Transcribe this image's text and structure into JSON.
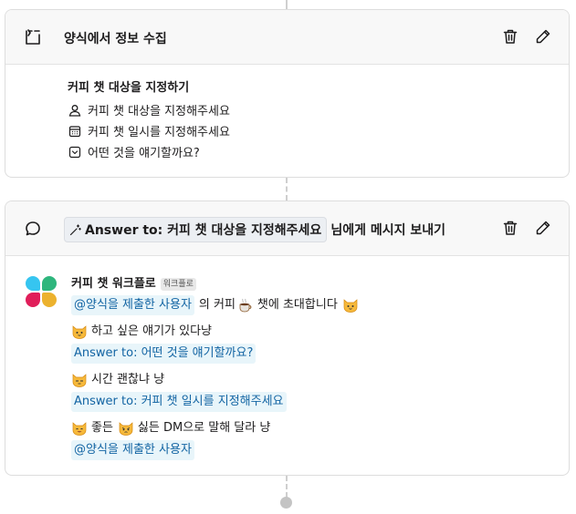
{
  "step1": {
    "title": "양식에서 정보 수집",
    "form_title": "커피 챗 대상을 지정하기",
    "fields": [
      {
        "icon": "person-icon",
        "label": "커피 챗 대상을 지정해주세요"
      },
      {
        "icon": "calendar-icon",
        "label": "커피 챗 일시를 지정해주세요"
      },
      {
        "icon": "dropdown-icon",
        "label": "어떤 것을 얘기할까요?"
      }
    ]
  },
  "step2": {
    "token_label": "Answer to: 커피 챗 대상을 지정해주세요",
    "title_suffix": "님에게 메시지 보내기",
    "sender": "커피 챗 워크플로",
    "sender_badge": "워크플로",
    "line1_var": "@양식을 제출한 사용자",
    "line1_text_a": "의 커피",
    "line1_text_b": "챗에 초대합니다",
    "line2_text": "하고 싶은 얘기가 있다냥",
    "line2_var": "Answer to: 어떤 것을 얘기할까요?",
    "line3_text": "시간 괜찮냐 냥",
    "line3_var": "Answer to: 커피 챗 일시를 지정해주세요",
    "line4_text_a": "좋든",
    "line4_text_b": "싫든 DM으로 말해 달라 냥",
    "line4_var": "@양식을 제출한 사용자"
  },
  "colors": {
    "variable_text": "#1264a3",
    "variable_bg": "#e8f5fa",
    "header_bg": "#f8f8f8"
  }
}
